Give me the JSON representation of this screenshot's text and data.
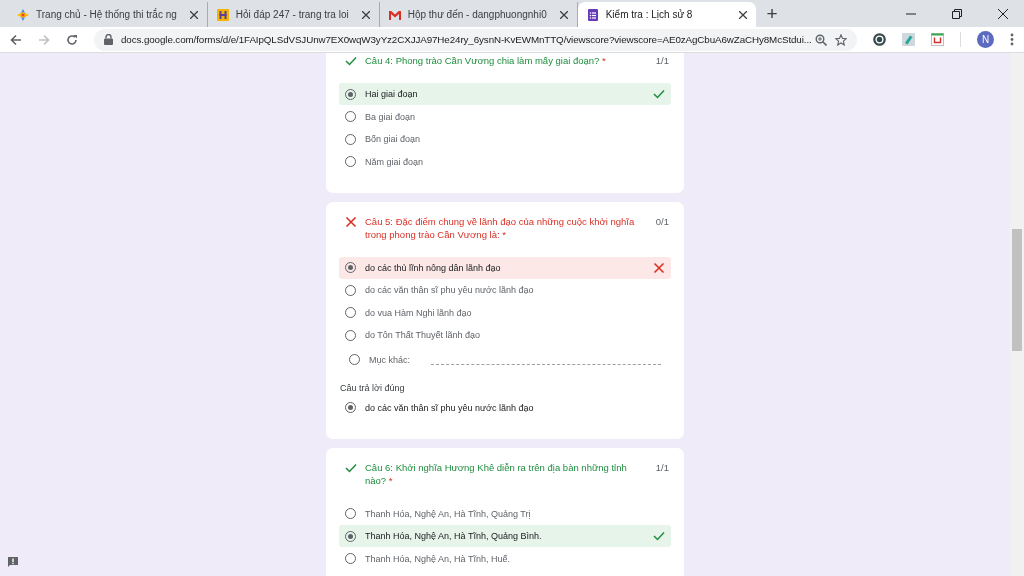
{
  "browser": {
    "tabs": [
      {
        "title": "Trang chủ - Hệ thống thi trắc ng",
        "kind": "diamond",
        "selected": false
      },
      {
        "title": "Hỏi đáp 247 - trang tra loi",
        "kind": "h",
        "selected": false
      },
      {
        "title": "Hộp thư đến - dangphuongnhi0",
        "kind": "mail",
        "selected": false
      },
      {
        "title": "Kiểm tra : Lịch sử 8",
        "kind": "form",
        "selected": true
      }
    ],
    "new_tab": "+",
    "url": "docs.google.com/forms/d/e/1FAIpQLSdVSJUnw7EX0wqW3yYz2CXJJA97He24ry_6ysnN-KvEWMnTTQ/viewscore?viewscore=AE0zAgCbuA6wZaCHy8McStdui...",
    "avatar": "N"
  },
  "questions": [
    {
      "correct": true,
      "title": "Câu 4: Phong trào Cần Vương chia làm mấy giai đoạn?",
      "required": "*",
      "score": "1/1",
      "options": [
        {
          "label": "Hai giai đoạn",
          "selected": true
        },
        {
          "label": "Ba giai đoạn",
          "selected": false
        },
        {
          "label": "Bốn giai đoạn",
          "selected": false
        },
        {
          "label": "Năm giai đoạn",
          "selected": false
        }
      ]
    },
    {
      "correct": false,
      "title": "Câu 5: Đặc điểm chung về lãnh đạo của những cuộc khởi nghĩa trong phong trào Cần Vương là:",
      "required": "*",
      "score": "0/1",
      "options": [
        {
          "label": "do các thủ lĩnh nông dân lãnh đạo",
          "selected": true
        },
        {
          "label": "do các văn thân sĩ phu yêu nước lãnh đạo",
          "selected": false
        },
        {
          "label": "do vua Hàm Nghi lãnh đạo",
          "selected": false
        },
        {
          "label": "do Tôn Thất Thuyết lãnh đạo",
          "selected": false
        }
      ],
      "other": {
        "label": "Mục khác:",
        "selected": false
      },
      "correct_answer": {
        "heading": "Câu trả lời đúng",
        "selected": true,
        "label": "do các văn thân sĩ phu yêu nước lãnh đạo"
      }
    },
    {
      "correct": true,
      "title": "Câu 6: Khởi nghĩa Hương Khê diễn ra trên địa bàn những tỉnh nào?",
      "required": "*",
      "score": "1/1",
      "options": [
        {
          "label": "Thanh Hóa, Nghệ An, Hà Tĩnh, Quảng Trị",
          "selected": false
        },
        {
          "label": "Thanh Hóa, Nghệ An, Hà Tĩnh, Quảng Bình.",
          "selected": true
        },
        {
          "label": "Thanh Hóa, Nghệ An, Hà Tĩnh, Huế.",
          "selected": false
        }
      ]
    }
  ]
}
